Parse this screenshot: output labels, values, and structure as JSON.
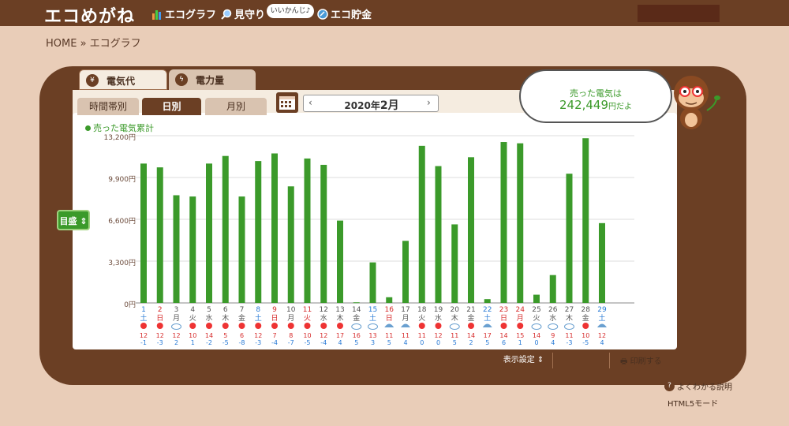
{
  "header": {
    "logo": "エコめがね",
    "nav": [
      {
        "label": "エコグラフ",
        "icon": "bar-chart-icon"
      },
      {
        "label": "見守り",
        "icon": "magnifier-icon"
      },
      {
        "label": "エコ貯金",
        "icon": "coin-icon"
      }
    ],
    "status_bubble": "いいかんじ♪"
  },
  "breadcrumb": "HOME » エコグラフ",
  "main_tabs": [
    {
      "label": "電気代",
      "icon": "yen-icon"
    },
    {
      "label": "電力量",
      "icon": "lightning-icon"
    }
  ],
  "sub_tabs": [
    "時間帯別",
    "日別",
    "月別"
  ],
  "month_nav": {
    "prefix": "2020年",
    "month": "2月",
    "prev": "‹",
    "next": "›"
  },
  "sold_panel": {
    "line1": "売った電気は",
    "value": "242,449",
    "unit": "円だよ"
  },
  "legend_label": "売った電気累計",
  "target_button": "目盛",
  "buttons": {
    "display_settings": "表示設定",
    "print": "印刷する"
  },
  "footer": {
    "help": "よくわかる説明",
    "html5": "HTML5モード"
  },
  "colors": {
    "bar": "#3b9a2a",
    "saturday": "#2a7bd6",
    "sunday": "#d62a2a",
    "frame": "#6b3f24"
  },
  "chart_data": {
    "type": "bar",
    "ylim": [
      0,
      13200
    ],
    "yticks": [
      "0円",
      "3,300円",
      "6,600円",
      "9,900円",
      "13,200円"
    ],
    "days": [
      "1",
      "2",
      "3",
      "4",
      "5",
      "6",
      "7",
      "8",
      "9",
      "10",
      "11",
      "12",
      "13",
      "14",
      "15",
      "16",
      "17",
      "18",
      "19",
      "20",
      "21",
      "22",
      "23",
      "24",
      "25",
      "26",
      "27",
      "28",
      "29"
    ],
    "weekdays": [
      "土",
      "日",
      "月",
      "火",
      "水",
      "木",
      "金",
      "土",
      "日",
      "月",
      "火",
      "水",
      "木",
      "金",
      "土",
      "日",
      "月",
      "火",
      "水",
      "木",
      "金",
      "土",
      "日",
      "月",
      "火",
      "水",
      "木",
      "金",
      "土"
    ],
    "weekday_type": [
      "sat",
      "sun",
      "",
      "",
      "",
      "",
      "",
      "sat",
      "sun",
      "",
      "hol",
      "",
      "",
      "",
      "sat",
      "sun",
      "",
      "",
      "",
      "",
      "",
      "sat",
      "sun",
      "hol",
      "",
      "",
      "",
      "",
      "sat"
    ],
    "values": [
      11000,
      10700,
      8500,
      8400,
      11000,
      11600,
      8400,
      11200,
      11800,
      9200,
      11400,
      10900,
      6500,
      50,
      3200,
      450,
      4900,
      12400,
      10800,
      6200,
      11500,
      300,
      12700,
      12600,
      650,
      2200,
      10200,
      13000,
      6300
    ],
    "weather": [
      "sun",
      "sun",
      "cloud",
      "sun",
      "sun",
      "sun",
      "sun",
      "sun",
      "sun",
      "sun",
      "sun",
      "sun",
      "sun",
      "cloud",
      "cloud",
      "rain",
      "rain",
      "sun",
      "sun",
      "cloud",
      "sun",
      "rain",
      "sun",
      "sun",
      "cloud",
      "cloud",
      "cloud",
      "sun",
      "rain"
    ],
    "temp_high": [
      "12",
      "12",
      "12",
      "10",
      "14",
      "5",
      "6",
      "12",
      "7",
      "8",
      "10",
      "12",
      "17",
      "16",
      "13",
      "11",
      "11",
      "11",
      "12",
      "11",
      "14",
      "17",
      "14",
      "15",
      "14",
      "9",
      "11",
      "10",
      "12"
    ],
    "temp_low": [
      "-1",
      "-3",
      "2",
      "1",
      "-2",
      "-5",
      "-8",
      "-3",
      "-4",
      "-7",
      "-5",
      "-4",
      "4",
      "5",
      "3",
      "5",
      "4",
      "0",
      "0",
      "5",
      "2",
      "5",
      "6",
      "1",
      "0",
      "4",
      "-3",
      "-5",
      "4"
    ]
  }
}
